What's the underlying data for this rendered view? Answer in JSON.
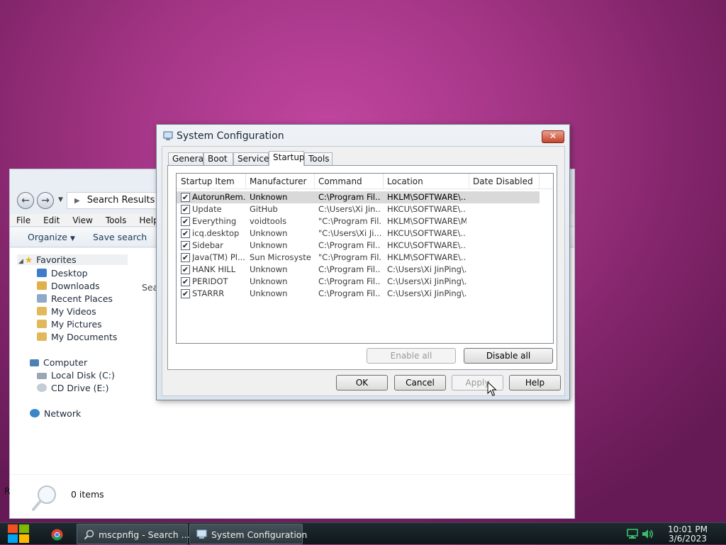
{
  "explorer": {
    "address": "Search Results",
    "menu": [
      "File",
      "Edit",
      "View",
      "Tools",
      "Help"
    ],
    "organize_label": "Organize",
    "save_search_label": "Save search",
    "content_partial_text": "Sea",
    "nav": {
      "favorites": "Favorites",
      "desktop": "Desktop",
      "downloads": "Downloads",
      "recent_places": "Recent Places",
      "my_videos": "My Videos",
      "my_pictures": "My Pictures",
      "my_documents": "My Documents",
      "computer": "Computer",
      "local_disk": "Local Disk (C:)",
      "cd_drive": "CD Drive (E:)",
      "network": "Network"
    },
    "status": "0 items",
    "edge_char": "R"
  },
  "dialog": {
    "title": "System Configuration",
    "close_label": "✕",
    "tabs": [
      "General",
      "Boot",
      "Services",
      "Startup",
      "Tools"
    ],
    "active_tab": "Startup",
    "columns": [
      "Startup Item",
      "Manufacturer",
      "Command",
      "Location",
      "Date Disabled"
    ],
    "rows": [
      {
        "item": "AutorunRem...",
        "manufacturer": "Unknown",
        "command": "C:\\Program Fil...",
        "location": "HKLM\\SOFTWARE\\...",
        "date": "",
        "checked": true,
        "selected": true
      },
      {
        "item": "Update",
        "manufacturer": "GitHub",
        "command": "C:\\Users\\Xi Jin...",
        "location": "HKCU\\SOFTWARE\\...",
        "date": "",
        "checked": true,
        "selected": false
      },
      {
        "item": "Everything",
        "manufacturer": "voidtools",
        "command": "\"C:\\Program Fil...",
        "location": "HKLM\\SOFTWARE\\M...",
        "date": "",
        "checked": true,
        "selected": false
      },
      {
        "item": "icq.desktop",
        "manufacturer": "Unknown",
        "command": "\"C:\\Users\\Xi Ji...",
        "location": "HKCU\\SOFTWARE\\...",
        "date": "",
        "checked": true,
        "selected": false
      },
      {
        "item": "Sidebar",
        "manufacturer": "Unknown",
        "command": "C:\\Program Fil...",
        "location": "HKCU\\SOFTWARE\\...",
        "date": "",
        "checked": true,
        "selected": false
      },
      {
        "item": "Java(TM) Pl...",
        "manufacturer": "Sun Microsyste...",
        "command": "\"C:\\Program Fil...",
        "location": "HKLM\\SOFTWARE\\...",
        "date": "",
        "checked": true,
        "selected": false
      },
      {
        "item": "HANK HILL",
        "manufacturer": "Unknown",
        "command": "C:\\Program Fil...",
        "location": "C:\\Users\\Xi JinPing\\...",
        "date": "",
        "checked": true,
        "selected": false
      },
      {
        "item": "PERIDOT",
        "manufacturer": "Unknown",
        "command": "C:\\Program Fil...",
        "location": "C:\\Users\\Xi JinPing\\...",
        "date": "",
        "checked": true,
        "selected": false
      },
      {
        "item": "STARRR",
        "manufacturer": "Unknown",
        "command": "C:\\Program Fil...",
        "location": "C:\\Users\\Xi JinPing\\...",
        "date": "",
        "checked": true,
        "selected": false
      }
    ],
    "enable_all": "Enable all",
    "disable_all": "Disable all",
    "ok": "OK",
    "cancel": "Cancel",
    "apply": "Apply",
    "help": "Help"
  },
  "taskbar": {
    "items": [
      {
        "label": "mscpnfig - Search ..."
      },
      {
        "label": "System Configuration"
      }
    ],
    "time": "10:01 PM",
    "date": "3/6/2023"
  },
  "colors": {
    "desktop": "#a33585",
    "selection": "#d9d9d9",
    "close": "#c6452c"
  }
}
